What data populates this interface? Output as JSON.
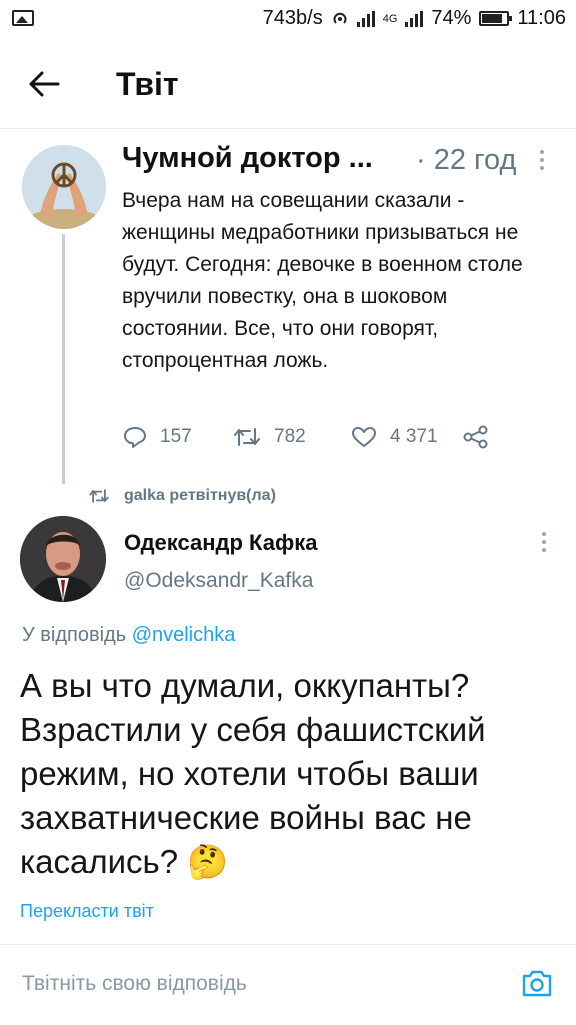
{
  "status_bar": {
    "speed": "743b/s",
    "network": "4G",
    "battery": "74%",
    "time": "11:06"
  },
  "header": {
    "title": "Твіт"
  },
  "quoted_tweet": {
    "author_name": "Чумной доктор ...",
    "time": "· 22 год",
    "text": "Вчера нам на совещании сказали - женщины медработники призываться не будут. Сегодня: девочке в военном столе вручили повестку, она в шоковом состоянии. Все, что они говорят, стопроцентная ложь.",
    "replies": "157",
    "retweets": "782",
    "likes": "4 371"
  },
  "retweet_label": "galka ретвітнув(ла)",
  "main_tweet": {
    "author_name": "Одександр Кафка",
    "handle": "@Odeksandr_Kafka",
    "reply_prefix": "У відповідь",
    "reply_to": "@nvelichka",
    "text": "А вы что думали, оккупанты? Взрастили у себя фашистский режим, но хотели чтобы ваши захватнические войны вас не касались? 🤔",
    "translate_label": "Перекласти твіт"
  },
  "compose": {
    "placeholder": "Твітніть свою відповідь"
  },
  "colors": {
    "accent": "#1da1f2",
    "muted": "#657786",
    "divider": "#e6ecf0"
  },
  "icons": [
    "image-icon",
    "hotspot-icon",
    "signal-icon",
    "battery-icon",
    "back-arrow-icon",
    "more-icon",
    "reply-icon",
    "retweet-icon",
    "like-icon",
    "share-icon",
    "camera-icon"
  ]
}
